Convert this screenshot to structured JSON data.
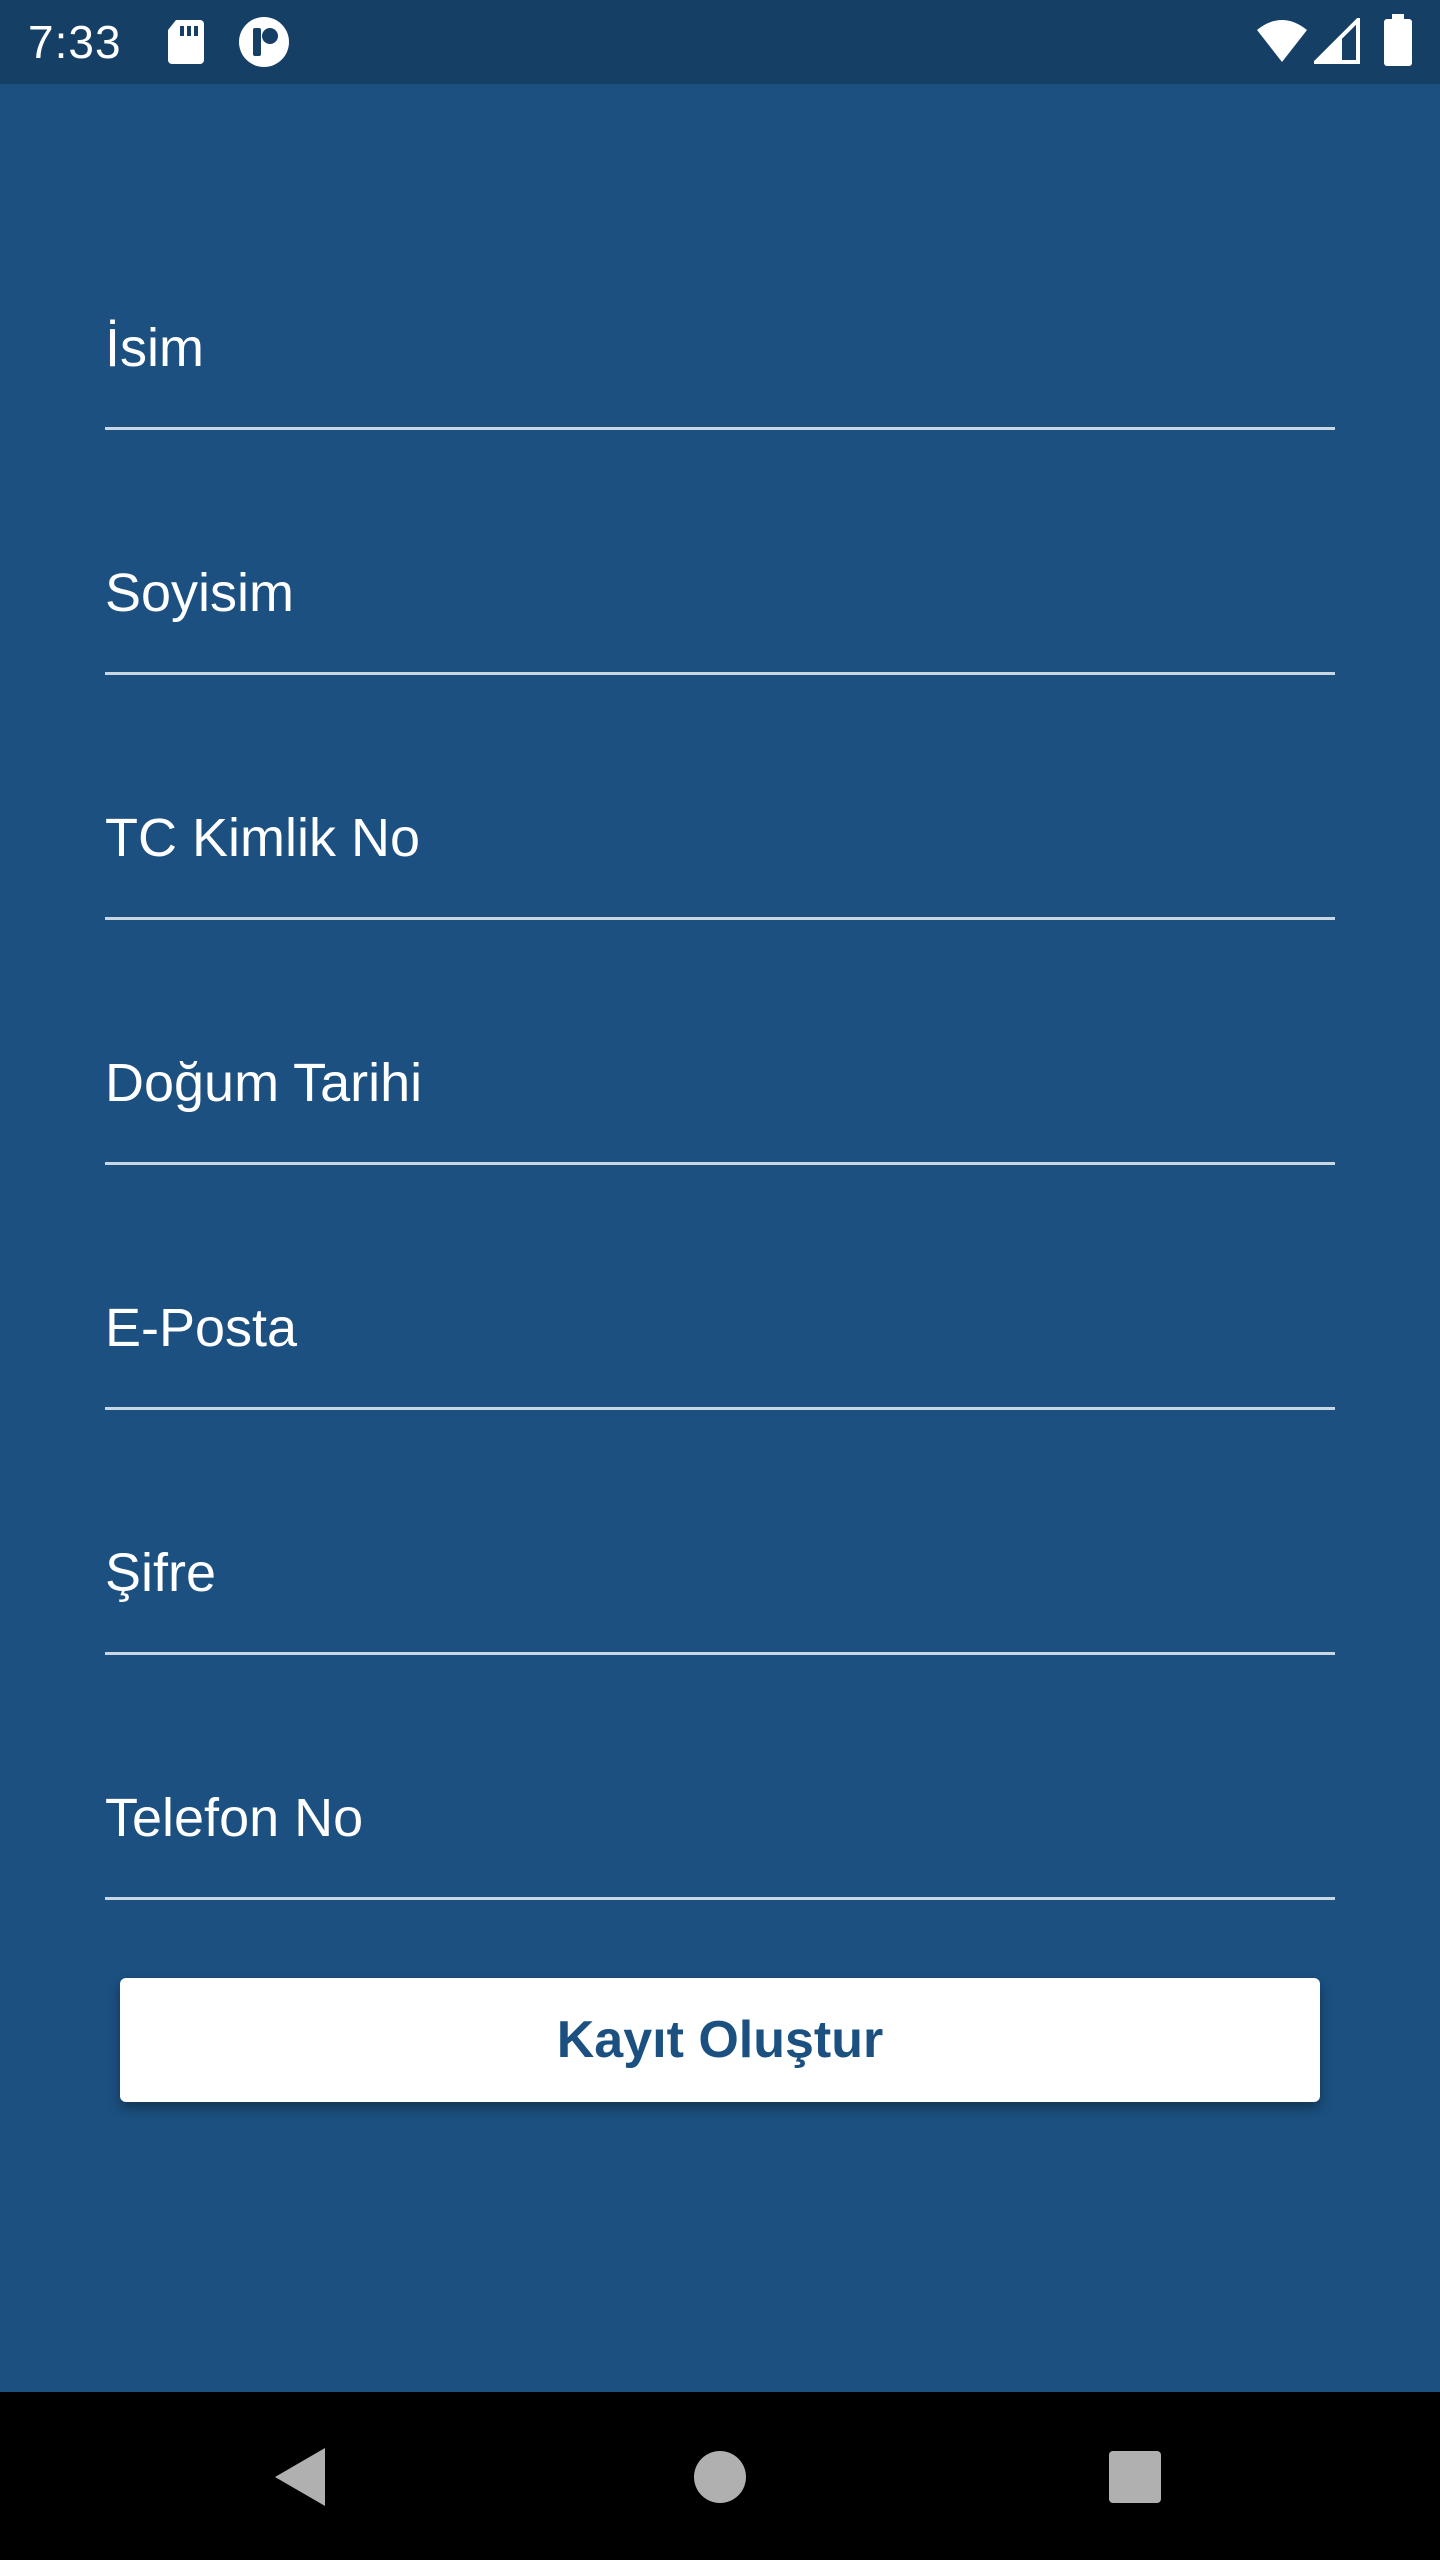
{
  "status_bar": {
    "time": "7:33",
    "icons": [
      "sd-card-icon",
      "app-notification-icon",
      "wifi-icon",
      "cell-signal-icon",
      "battery-icon"
    ]
  },
  "form": {
    "fields": [
      {
        "label": "İsim"
      },
      {
        "label": "Soyisim"
      },
      {
        "label": "TC Kimlik No"
      },
      {
        "label": "Doğum Tarihi"
      },
      {
        "label": "E-Posta"
      },
      {
        "label": "Şifre"
      },
      {
        "label": "Telefon No"
      }
    ],
    "submit_label": "Kayıt Oluştur"
  },
  "nav_bar": {
    "buttons": [
      "back-icon",
      "home-icon",
      "recents-icon"
    ]
  },
  "colors": {
    "background": "#1b5080",
    "status_bar": "#163f66",
    "text": "#ffffff",
    "underline": "#c9d6e3",
    "button_bg": "#ffffff",
    "button_text": "#1b5080",
    "nav_bar": "#000000"
  }
}
